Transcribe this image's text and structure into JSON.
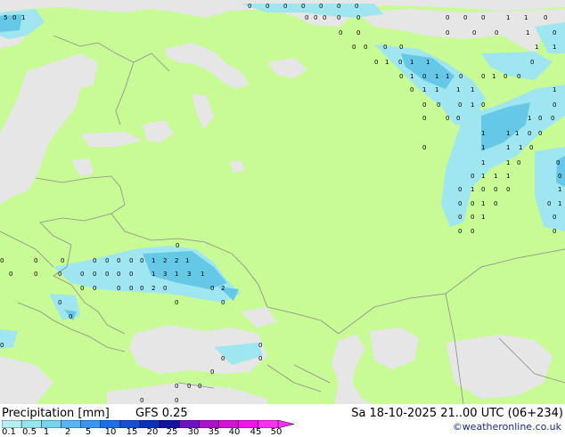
{
  "legend": {
    "title": "Precipitation [mm]",
    "model": "GFS 0.25",
    "valid_time": "Sa 18-10-2025 21..00 UTC (06+234)",
    "credit": "©weatheronline.co.uk",
    "ticks": [
      "0.1",
      "0.5",
      "1",
      "2",
      "5",
      "10",
      "15",
      "20",
      "25",
      "30",
      "35",
      "40",
      "45",
      "50"
    ],
    "colors": [
      "#b4f0f0",
      "#96e6f0",
      "#78d2f0",
      "#5ab4f0",
      "#3c96f0",
      "#1e6ee6",
      "#1450d2",
      "#0a32b4",
      "#1414a0",
      "#6e14be",
      "#aa14c8",
      "#d214d2",
      "#f014e6",
      "#fa32f0"
    ]
  },
  "map": {
    "land_color": "#c8fa96",
    "sea_color": "#e6e6e6",
    "border_color": "#8c8c8c",
    "precip_color": "#a0e6f0",
    "precip_dark_color": "#64c8e6"
  }
}
